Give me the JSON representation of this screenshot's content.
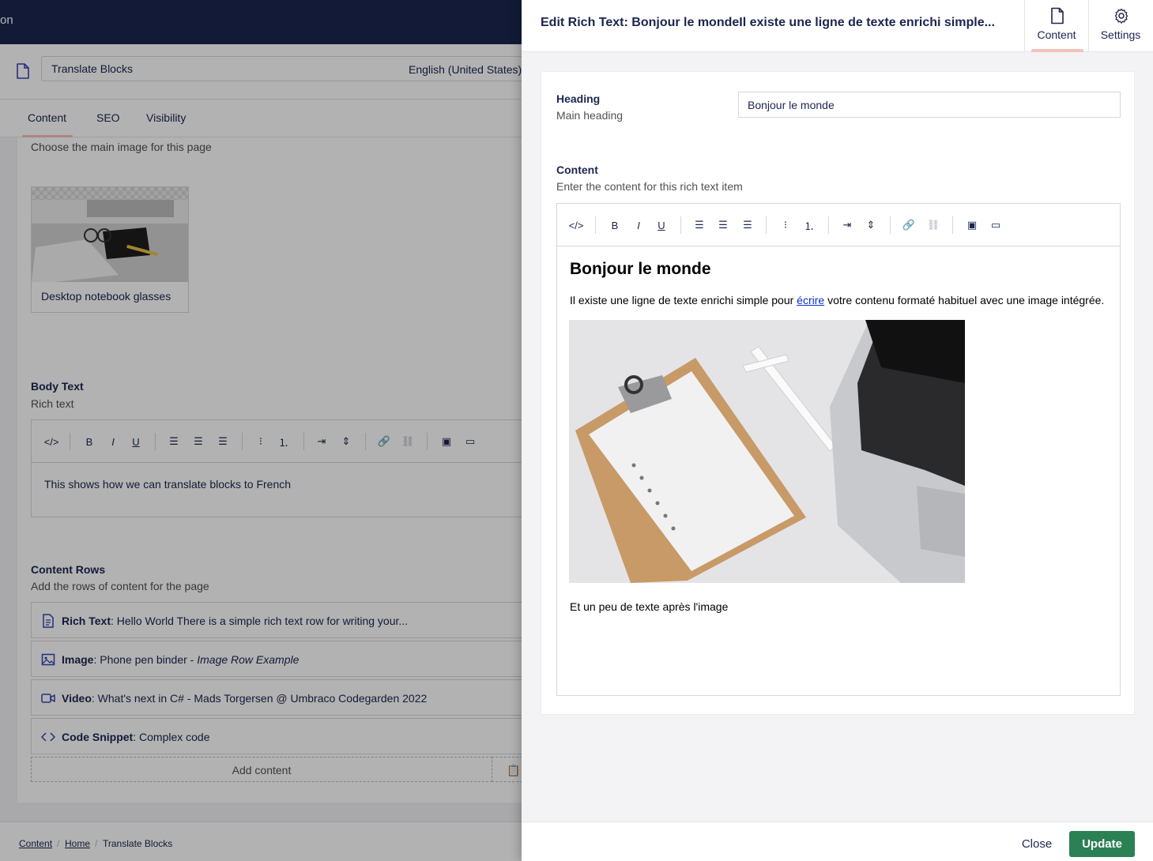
{
  "topbar": {
    "partial_text": "on"
  },
  "document": {
    "name": "Translate Blocks",
    "culture": "English (United States)"
  },
  "bg_tabs": [
    "Content",
    "SEO",
    "Visibility"
  ],
  "main_image": {
    "description": "Choose the main image for this page",
    "media_caption": "Desktop notebook glasses"
  },
  "body_text": {
    "label": "Body Text",
    "description": "Rich text",
    "content": "This shows how we can translate blocks to French"
  },
  "content_rows": {
    "label": "Content Rows",
    "description": "Add the rows of content for the page",
    "items": [
      {
        "type": "Rich Text",
        "text": "Hello World There is a simple rich text row for writing your...",
        "icon": "document-icon"
      },
      {
        "type": "Image",
        "text": "Phone pen binder - ",
        "extra": "Image Row Example",
        "icon": "image-icon"
      },
      {
        "type": "Video",
        "text": "What's next in C# - Mads Torgersen @ Umbraco Codegarden 2022",
        "icon": "video-icon"
      },
      {
        "type": "Code Snippet",
        "text": "Complex code",
        "icon": "code-icon"
      }
    ],
    "add_label": "Add content"
  },
  "breadcrumb": [
    "Content",
    "Home",
    "Translate Blocks"
  ],
  "dialog": {
    "title": "Edit Rich Text: Bonjour le mondeIl existe une ligne de texte enrichi simple...",
    "tabs": [
      {
        "label": "Content",
        "icon": "document-icon"
      },
      {
        "label": "Settings",
        "icon": "gear-icon"
      }
    ],
    "heading": {
      "label": "Heading",
      "description": "Main heading",
      "value": "Bonjour le monde"
    },
    "content": {
      "label": "Content",
      "description": "Enter the content for this rich text item",
      "h1": "Bonjour le monde",
      "p1_before": "Il existe une ligne de texte enrichi simple pour ",
      "p1_link": "écrire",
      "p1_after": " votre contenu formaté habituel avec une image intégrée.",
      "p2": "Et un peu de texte après l'image"
    },
    "close_label": "Close",
    "update_label": "Update"
  },
  "colors": {
    "brand_dark": "#1b264f",
    "update_green": "#2b8054",
    "tab_active": "#f5c1bc",
    "link": "#0b2fcb"
  }
}
